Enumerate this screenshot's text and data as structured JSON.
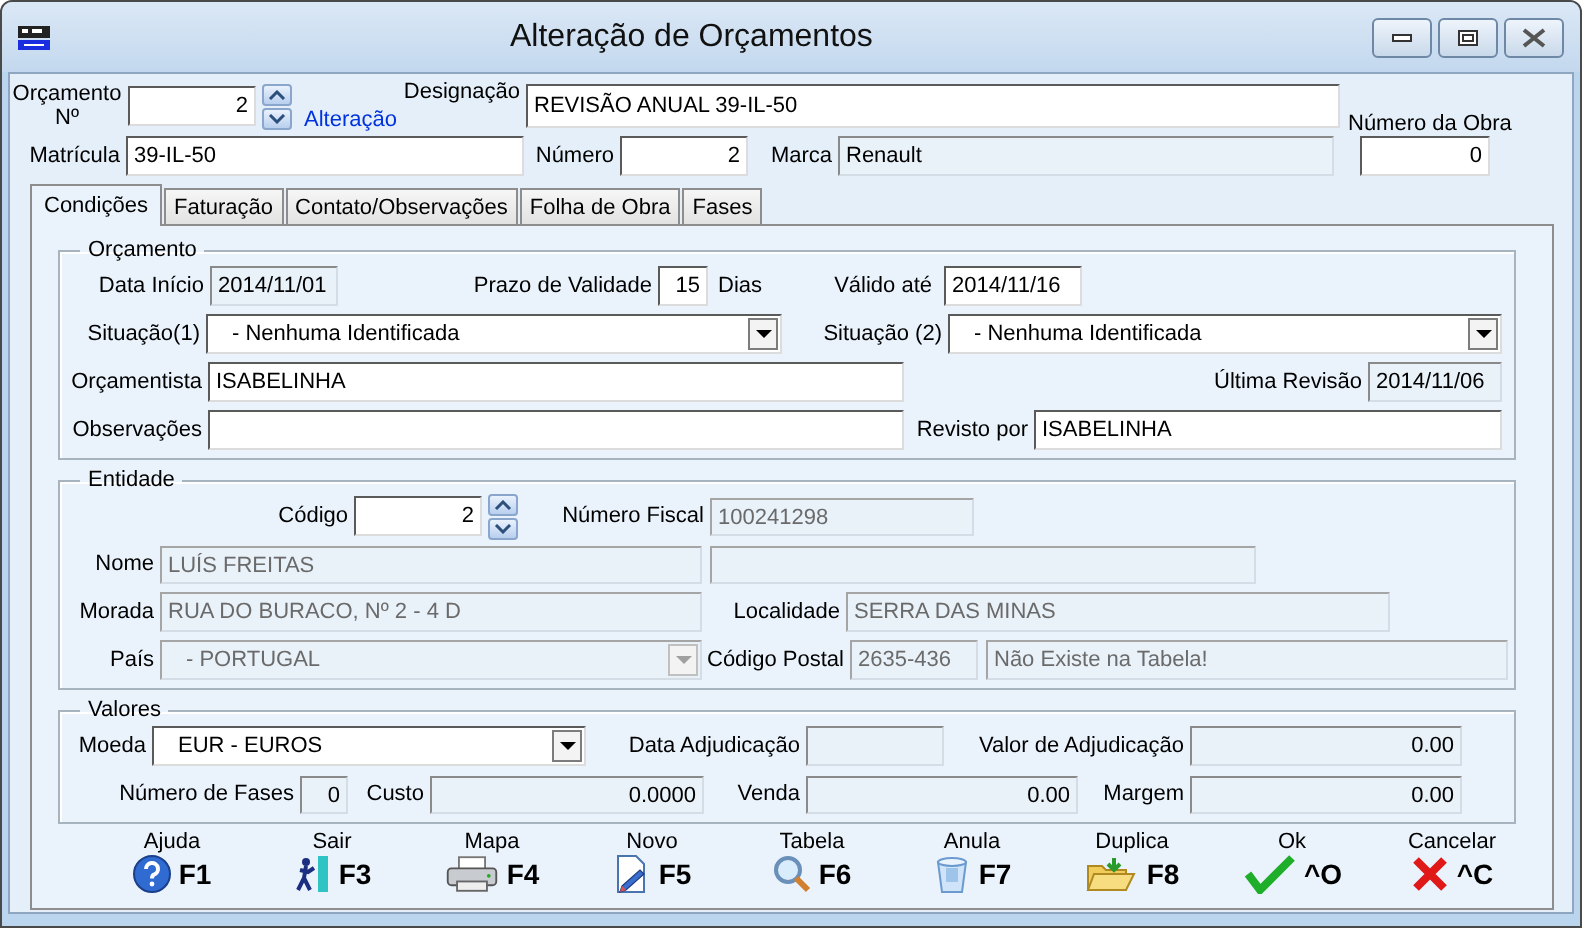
{
  "window": {
    "title": "Alteração de Orçamentos"
  },
  "header": {
    "orcamento_no": {
      "label": "Orçamento Nº",
      "value": "2",
      "readonly": false
    },
    "mode": "Alteração",
    "designacao": {
      "label": "Designação",
      "value": "REVISÃO ANUAL 39-IL-50",
      "readonly": false
    },
    "numero_da_obra": {
      "label": "Número da Obra",
      "value": "0",
      "readonly": false
    },
    "matricula": {
      "label": "Matrícula",
      "value": "39-IL-50",
      "readonly": false
    },
    "numero": {
      "label": "Número",
      "value": "2",
      "readonly": false
    },
    "marca": {
      "label": "Marca",
      "value": "Renault",
      "readonly": true
    }
  },
  "tabs": [
    {
      "label": "Condições",
      "selected": true
    },
    {
      "label": "Faturação",
      "selected": false
    },
    {
      "label": "Contato/Observações",
      "selected": false
    },
    {
      "label": "Folha de Obra",
      "selected": false
    },
    {
      "label": "Fases",
      "selected": false
    }
  ],
  "orcamento": {
    "title": "Orçamento",
    "data_inicio": {
      "label": "Data Início",
      "value": "2014/11/01",
      "readonly": true
    },
    "prazo_de_validade": {
      "label": "Prazo de Validade",
      "value": "15",
      "unit": "Dias",
      "readonly": false
    },
    "valido_ate": {
      "label": "Válido até",
      "value": "2014/11/16",
      "readonly": false
    },
    "situacao_1": {
      "label": "Situação(1)",
      "value": "- Nenhuma Identificada",
      "readonly": false
    },
    "situacao_2": {
      "label": "Situação (2)",
      "value": "- Nenhuma Identificada",
      "readonly": false
    },
    "orcamentista": {
      "label": "Orçamentista",
      "value": "ISABELINHA",
      "readonly": false
    },
    "ultima_revisao": {
      "label": "Última Revisão",
      "value": "2014/11/06",
      "readonly": true
    },
    "observacoes": {
      "label": "Observações",
      "readonly": false
    },
    "revisto_por": {
      "label": "Revisto por",
      "value": "ISABELINHA",
      "readonly": false
    }
  },
  "entidade": {
    "title": "Entidade",
    "codigo": {
      "label": "Código",
      "value": "2",
      "disabled": false
    },
    "numero_fiscal": {
      "label": "Número Fiscal",
      "value": "100241298",
      "disabled": true
    },
    "nome": {
      "label": "Nome",
      "value": "LUÍS FREITAS",
      "disabled": true
    },
    "nome_2": {
      "disabled": true
    },
    "morada": {
      "label": "Morada",
      "value": "RUA DO BURACO, Nº 2 - 4 D",
      "disabled": true
    },
    "localidade": {
      "label": "Localidade",
      "value": "SERRA DAS MINAS",
      "disabled": true
    },
    "pais": {
      "label": "País",
      "value": "- PORTUGAL",
      "disabled": true
    },
    "codigo_postal": {
      "label": "Código Postal",
      "value": "2635-436",
      "disabled": true
    },
    "codigo_postal_descricao": {
      "value": "Não Existe na Tabela!",
      "disabled": true
    }
  },
  "valores": {
    "title": "Valores",
    "moeda": {
      "label": "Moeda",
      "value": "EUR - EUROS",
      "readonly": false
    },
    "data_adjudicacao": {
      "label": "Data Adjudicação",
      "readonly": true
    },
    "valor_de_adjudicacao": {
      "label": "Valor de Adjudicação",
      "value": "0.00",
      "readonly": true
    },
    "numero_de_fases": {
      "label": "Número de Fases",
      "value": "0",
      "readonly": true
    },
    "custo": {
      "label": "Custo",
      "value": "0.0000",
      "readonly": true
    },
    "venda": {
      "label": "Venda",
      "value": "0.00",
      "readonly": true
    },
    "margem": {
      "label": "Margem",
      "value": "0.00",
      "readonly": true
    }
  },
  "toolbar": [
    {
      "label": "Ajuda",
      "key": "F1",
      "kind": "help"
    },
    {
      "label": "Sair",
      "key": "F3",
      "kind": "exit"
    },
    {
      "label": "Mapa",
      "key": "F4",
      "kind": "print"
    },
    {
      "label": "Novo",
      "key": "F5",
      "kind": "new"
    },
    {
      "label": "Tabela",
      "key": "F6",
      "kind": "table"
    },
    {
      "label": "Anula",
      "key": "F7",
      "kind": "cancel-doc"
    },
    {
      "label": "Duplica",
      "key": "F8",
      "kind": "duplicate"
    },
    {
      "label": "Ok",
      "key": "^O",
      "kind": "ok"
    },
    {
      "label": "Cancelar",
      "key": "^C",
      "kind": "close"
    }
  ]
}
